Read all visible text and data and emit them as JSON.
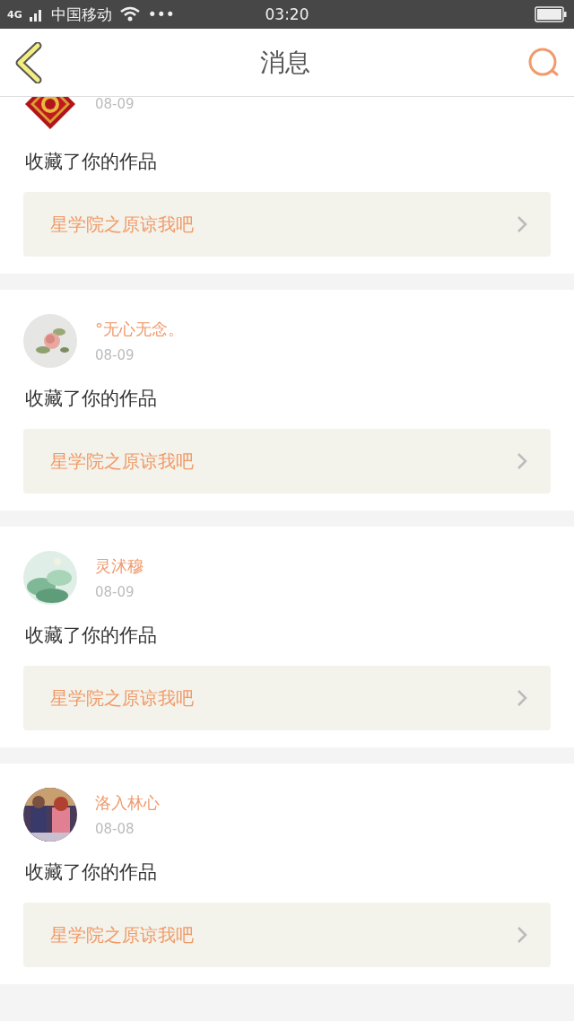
{
  "status_bar": {
    "network": "4G",
    "carrier": "中国移动",
    "dots": "•••",
    "time": "03:20"
  },
  "header": {
    "title": "消息"
  },
  "messages": [
    {
      "date": "08-09",
      "action": "收藏了你的作品",
      "work": "星学院之原谅我吧"
    },
    {
      "name": "°无心无念。",
      "date": "08-09",
      "action": "收藏了你的作品",
      "work": "星学院之原谅我吧"
    },
    {
      "name": "灵沭穆",
      "date": "08-09",
      "action": "收藏了你的作品",
      "work": "星学院之原谅我吧"
    },
    {
      "name": "洛入林心",
      "date": "08-08",
      "action": "收藏了你的作品",
      "work": "星学院之原谅我吧"
    }
  ]
}
